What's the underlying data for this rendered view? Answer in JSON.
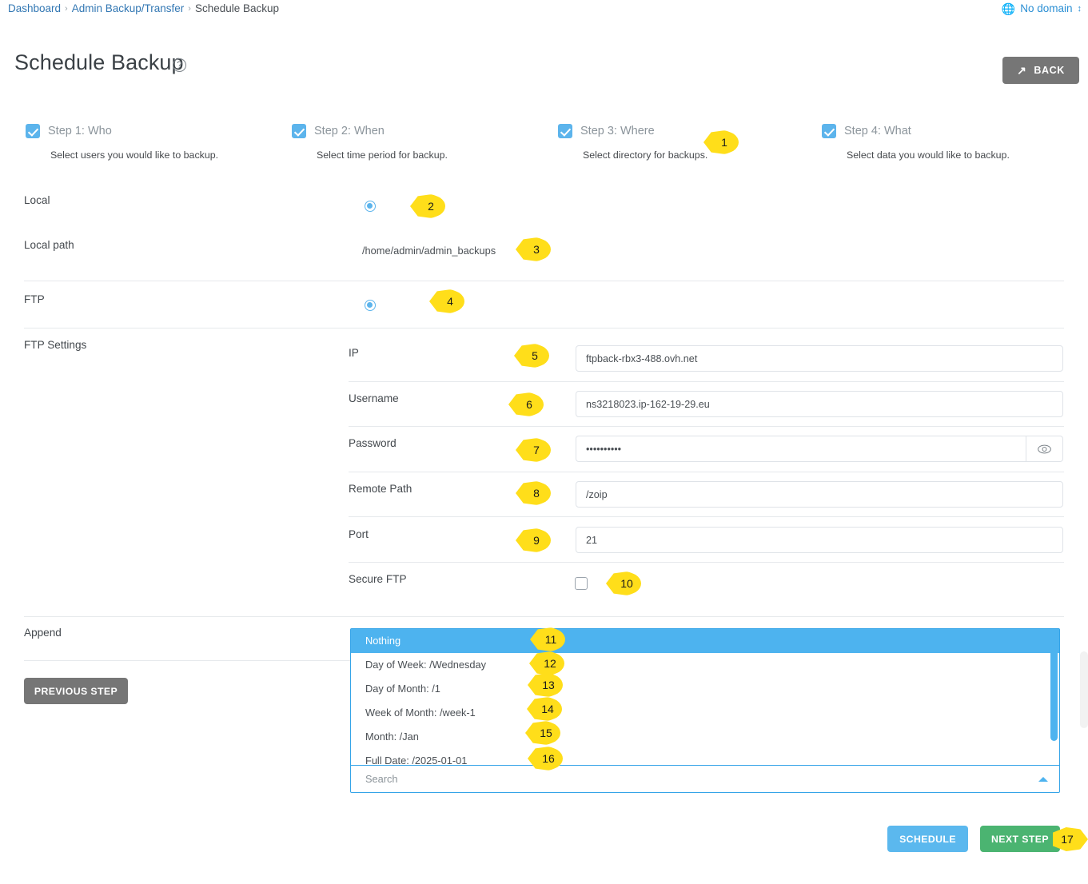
{
  "topbar": {
    "breadcrumb": [
      {
        "label": "Dashboard",
        "current": false
      },
      {
        "label": "Admin Backup/Transfer",
        "current": false
      },
      {
        "label": "Schedule Backup",
        "current": true
      }
    ],
    "separator": "›",
    "domain_label": "No domain",
    "globe_icon": "globe-icon",
    "updown_icon": "up-down-caret-icon"
  },
  "header": {
    "title": "Schedule Backup",
    "help_icon": "question-mark-icon",
    "help_glyph": "?",
    "back_label": "BACK",
    "back_icon": "share-arrow-icon",
    "back_glyph": "↗"
  },
  "steps": [
    {
      "title": "Step 1: Who",
      "sub": "Select users you would like to backup.",
      "checked": true
    },
    {
      "title": "Step 2: When",
      "sub": "Select time period for backup.",
      "checked": true
    },
    {
      "title": "Step 3: Where",
      "sub": "Select directory for backups.",
      "checked": true
    },
    {
      "title": "Step 4: What",
      "sub": "Select data you would like to backup.",
      "checked": true
    }
  ],
  "form": {
    "local_label": "Local",
    "local_selected": true,
    "local_path_label": "Local path",
    "local_path_value": "/home/admin/admin_backups",
    "ftp_label": "FTP",
    "ftp_selected": true,
    "ftp_settings_label": "FTP Settings",
    "fields": {
      "ip_label": "IP",
      "ip_value": "ftpback-rbx3-488.ovh.net",
      "username_label": "Username",
      "username_value": "ns3218023.ip-162-19-29.eu",
      "password_label": "Password",
      "password_value": "••••••••••",
      "password_eye_icon": "eye-icon",
      "remote_path_label": "Remote Path",
      "remote_path_value": "/zoip",
      "port_label": "Port",
      "port_value": "21",
      "secure_ftp_label": "Secure FTP",
      "secure_ftp_checked": false
    },
    "append_label": "Append"
  },
  "append_dropdown": {
    "options": [
      {
        "label": "Nothing",
        "selected": true
      },
      {
        "label": "Day of Week: /Wednesday",
        "selected": false
      },
      {
        "label": "Day of Month: /1",
        "selected": false
      },
      {
        "label": "Week of Month: /week-1",
        "selected": false
      },
      {
        "label": "Month: /Jan",
        "selected": false
      },
      {
        "label": "Full Date: /2025-01-01",
        "selected": false
      }
    ],
    "search_placeholder": "Search",
    "collapse_icon": "caret-up-icon"
  },
  "buttons": {
    "previous_step": "PREVIOUS STEP",
    "schedule": "SCHEDULE",
    "next_step": "NEXT STEP"
  },
  "markers": [
    {
      "n": "1"
    },
    {
      "n": "2"
    },
    {
      "n": "3"
    },
    {
      "n": "4"
    },
    {
      "n": "5"
    },
    {
      "n": "6"
    },
    {
      "n": "7"
    },
    {
      "n": "8"
    },
    {
      "n": "9"
    },
    {
      "n": "10"
    },
    {
      "n": "11"
    },
    {
      "n": "12"
    },
    {
      "n": "13"
    },
    {
      "n": "14"
    },
    {
      "n": "15"
    },
    {
      "n": "16"
    },
    {
      "n": "17"
    }
  ],
  "colors": {
    "accent_blue": "#5cb4ec",
    "dropdown_border": "#35a4e8",
    "selected_row": "#4db3ef",
    "green": "#4bb471",
    "grey_button": "#767676",
    "marker_yellow": "#ffde1a"
  }
}
